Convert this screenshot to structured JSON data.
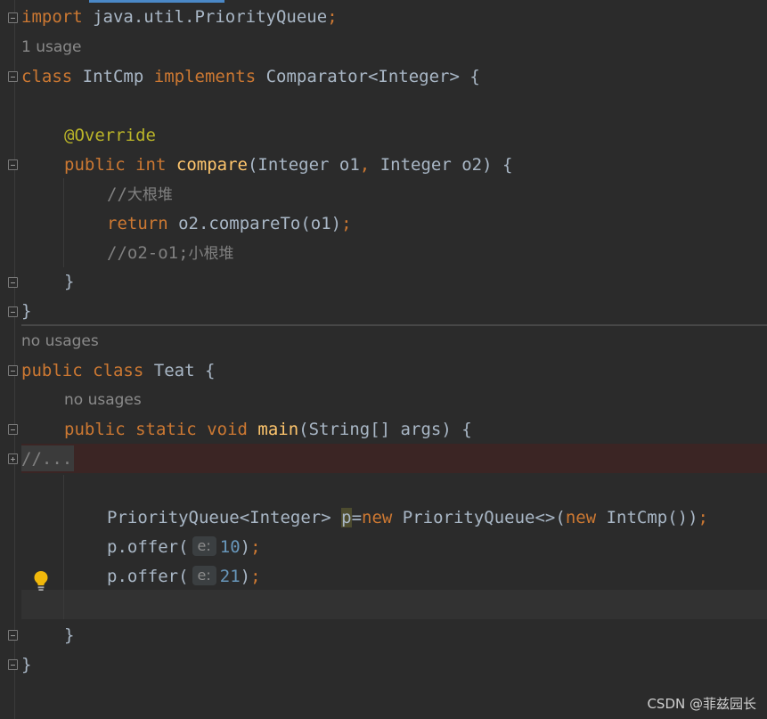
{
  "editor": {
    "import_keyword": "import",
    "import_path": "java.util.PriorityQueue",
    "semi": ";",
    "usage_1": "1 usage",
    "cls_keyword": "class",
    "cls_name": "IntCmp",
    "implements_keyword": "implements",
    "interface_type": "Comparator<Integer> {",
    "override_annotation": "@Override",
    "public_kw": "public",
    "int_kw": "int",
    "compare_fn": "compare",
    "compare_params_a": "(Integer o1",
    "comma": ",",
    "compare_params_b": " Integer o2) {",
    "comment_prefix": "//",
    "comment_bigheap": "大根堆",
    "return_kw": "return",
    "return_expr": "o2.compareTo(o1)",
    "comment_alt": "//o2-o1;",
    "comment_smallheap": "小根堆",
    "close_brace": "}",
    "no_usages_1": "no usages",
    "public_kw2": "public",
    "class_kw2": "class",
    "cls2_name": "Teat {",
    "no_usages_2": "no usages",
    "public_kw3": "public",
    "static_kw": "static",
    "void_kw": "void",
    "main_fn": "main",
    "main_params": "(String[] args) {",
    "folded_text": "//...",
    "pq_type": "PriorityQueue<Integer> ",
    "pq_var": "p",
    "eq": "=",
    "new_kw": "new",
    "pq_ctor": " PriorityQueue<>(",
    "new_kw2": "new",
    "pq_ctor_end": " IntCmp())",
    "offer_call": "p.offer(",
    "param_hint": "e:",
    "offer_val_1": "10",
    "offer_val_2": "21",
    "offer_end": ")"
  },
  "icons": {
    "bulb": "lightbulb-icon",
    "fold": "fold-icon",
    "unfold": "unfold-icon"
  },
  "colors": {
    "background": "#2b2b2b",
    "keyword": "#cc7832",
    "function": "#ffc66d",
    "annotation": "#bbb529",
    "comment": "#808080",
    "number": "#6897bb",
    "text": "#a9b7c6"
  },
  "watermark": "CSDN @菲兹园长"
}
